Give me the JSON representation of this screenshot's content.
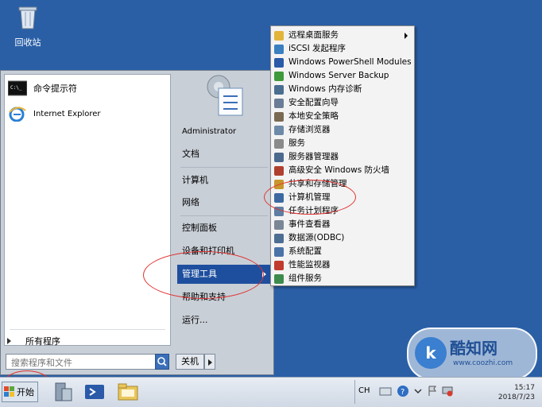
{
  "desktop": {
    "recycle_label": "回收站"
  },
  "start_menu": {
    "pinned": [
      {
        "label": "命令提示符",
        "icon": "cmd-icon"
      },
      {
        "label": "Internet Explorer",
        "icon": "ie-icon"
      }
    ],
    "all_programs": "所有程序",
    "search_placeholder": "搜索程序和文件",
    "shutdown_label": "关机",
    "right": {
      "user": "Administrator",
      "items": [
        "文档",
        "计算机",
        "网络",
        "控制面板",
        "设备和打印机",
        "管理工具",
        "帮助和支持",
        "运行..."
      ]
    }
  },
  "submenu": {
    "items": [
      {
        "label": "远程桌面服务",
        "icon": "folder-icon",
        "color": "#e2b43a"
      },
      {
        "label": "iSCSI 发起程序",
        "icon": "globe-icon",
        "color": "#3a7fc0"
      },
      {
        "label": "Windows PowerShell Modules",
        "icon": "powershell-icon",
        "color": "#2a5aa8"
      },
      {
        "label": "Windows Server Backup",
        "icon": "backup-icon",
        "color": "#3f9a3a"
      },
      {
        "label": "Windows 内存诊断",
        "icon": "memory-icon",
        "color": "#4a6e90"
      },
      {
        "label": "安全配置向导",
        "icon": "security-wizard-icon",
        "color": "#6b7d96"
      },
      {
        "label": "本地安全策略",
        "icon": "policy-icon",
        "color": "#7a6a52"
      },
      {
        "label": "存储浏览器",
        "icon": "storage-icon",
        "color": "#6d8aa8"
      },
      {
        "label": "服务",
        "icon": "services-icon",
        "color": "#8a8a8a"
      },
      {
        "label": "服务器管理器",
        "icon": "server-manager-icon",
        "color": "#4c6a8e"
      },
      {
        "label": "高级安全 Windows 防火墙",
        "icon": "firewall-icon",
        "color": "#b0402e"
      },
      {
        "label": "共享和存储管理",
        "icon": "share-icon",
        "color": "#c7962e"
      },
      {
        "label": "计算机管理",
        "icon": "computer-management-icon",
        "color": "#3c6aa0"
      },
      {
        "label": "任务计划程序",
        "icon": "task-scheduler-icon",
        "color": "#5e7ea2"
      },
      {
        "label": "事件查看器",
        "icon": "event-viewer-icon",
        "color": "#7a8796"
      },
      {
        "label": "数据源(ODBC)",
        "icon": "odbc-icon",
        "color": "#4d6e93"
      },
      {
        "label": "系统配置",
        "icon": "msconfig-icon",
        "color": "#4a73a8"
      },
      {
        "label": "性能监视器",
        "icon": "perf-monitor-icon",
        "color": "#c03a2e"
      },
      {
        "label": "组件服务",
        "icon": "component-services-icon",
        "color": "#3d8b4c"
      }
    ]
  },
  "taskbar": {
    "start_label": "开始",
    "lang": "CH",
    "time": "15:17",
    "date": "2018/7/23"
  },
  "watermark": {
    "logo_letter": "k",
    "name": "酷知网",
    "url": "www.coozhi.com"
  },
  "colors": {
    "accent": "#1e4f9e",
    "annotation": "#e0312f",
    "desktop": "#2a5fa6"
  }
}
